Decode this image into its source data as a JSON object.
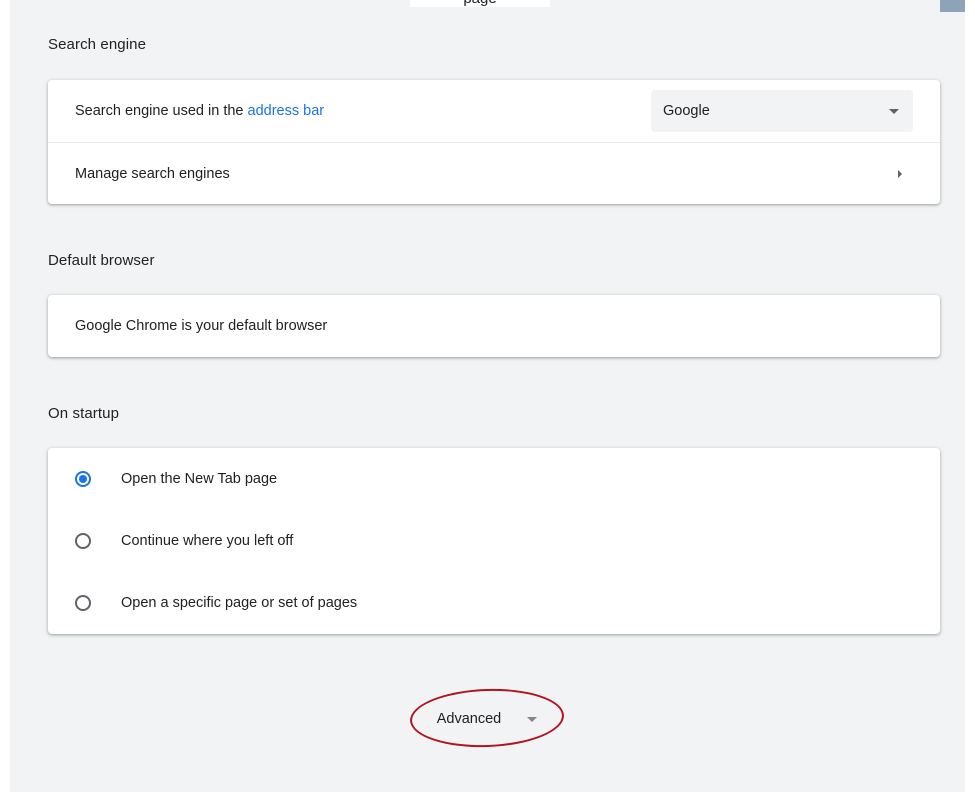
{
  "header": {
    "partial_title": "page"
  },
  "search_engine": {
    "section_title": "Search engine",
    "engine_label_prefix": "Search engine used in the ",
    "engine_label_link": "address bar",
    "selected_engine": "Google",
    "manage_label": "Manage search engines"
  },
  "default_browser": {
    "section_title": "Default browser",
    "status_text": "Google Chrome is your default browser"
  },
  "on_startup": {
    "section_title": "On startup",
    "options": [
      {
        "label": "Open the New Tab page",
        "checked": true
      },
      {
        "label": "Continue where you left off",
        "checked": false
      },
      {
        "label": "Open a specific page or set of pages",
        "checked": false
      }
    ]
  },
  "advanced": {
    "label": "Advanced"
  },
  "colors": {
    "accent": "#1a73e8",
    "background": "#f1f3f4",
    "annotation": "#b3121f"
  },
  "icons": {
    "dropdown": "chevron-down-icon",
    "submenu": "chevron-right-icon",
    "radio_on": "radio-checked-icon",
    "radio_off": "radio-unchecked-icon"
  }
}
